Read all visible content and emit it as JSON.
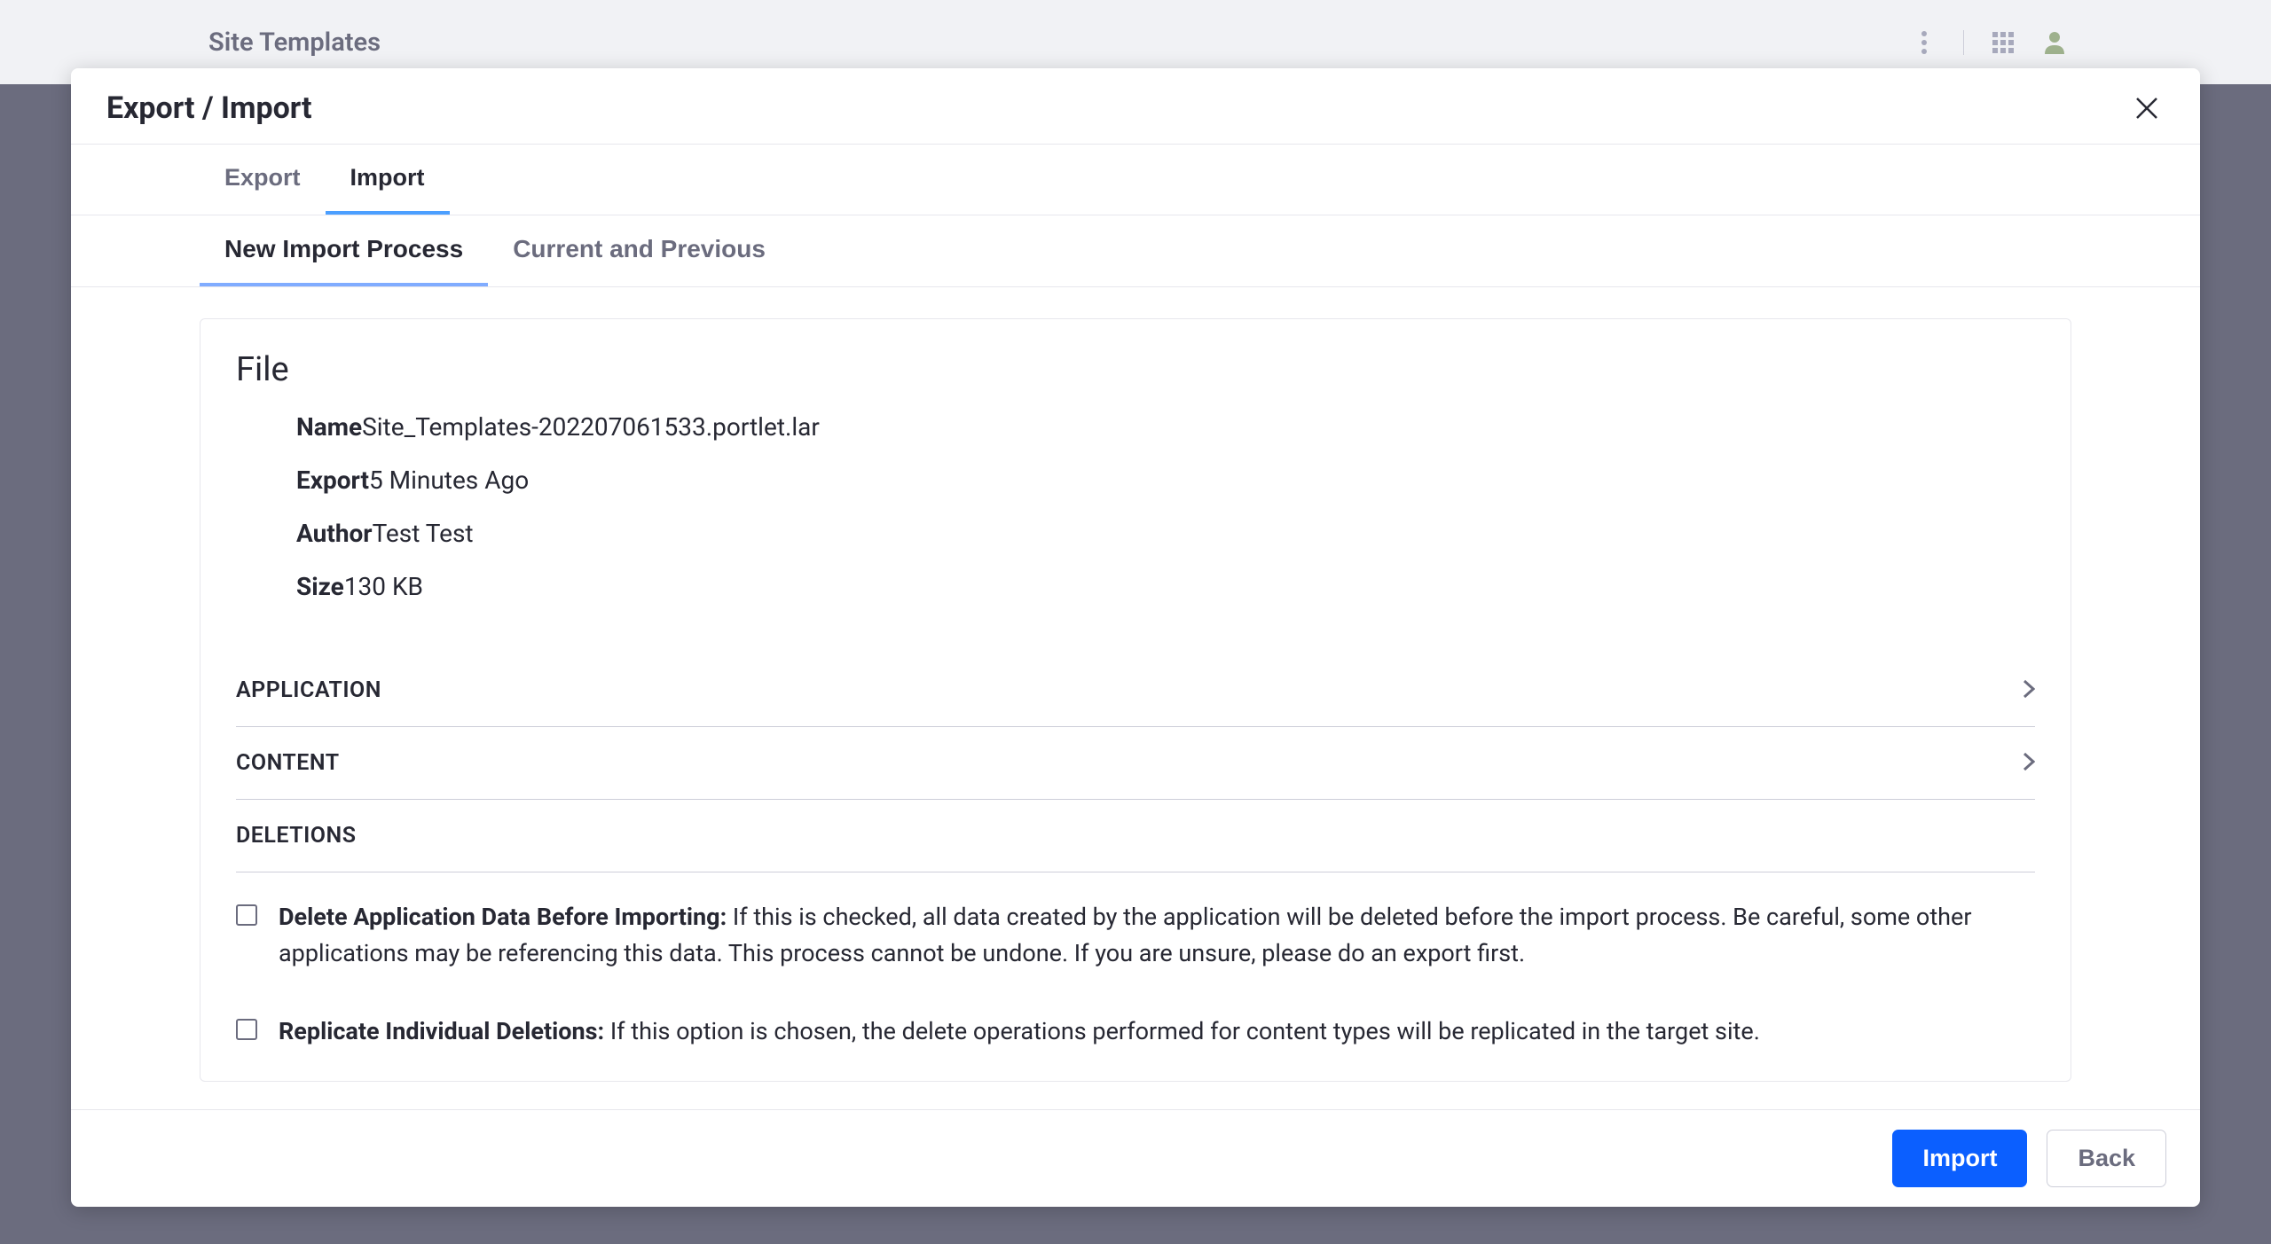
{
  "background": {
    "title": "Site Templates"
  },
  "modal": {
    "title": "Export / Import"
  },
  "tabs_primary": {
    "export": "Export",
    "import": "Import"
  },
  "tabs_secondary": {
    "new_import": "New Import Process",
    "current_previous": "Current and Previous"
  },
  "file": {
    "section_title": "File",
    "name_label": "Name",
    "name_value": "Site_Templates-202207061533.portlet.lar",
    "export_label": "Export",
    "export_value": "5 Minutes Ago",
    "author_label": "Author",
    "author_value": "Test Test",
    "size_label": "Size",
    "size_value": "130 KB"
  },
  "sections": {
    "application": "APPLICATION",
    "content": "CONTENT",
    "deletions": "DELETIONS"
  },
  "deletions": {
    "delete_data_label": "Delete Application Data Before Importing: ",
    "delete_data_text": "If this is checked, all data created by the application will be deleted before the import process. Be careful, some other applications may be referencing this data. This process cannot be undone. If you are unsure, please do an export first.",
    "replicate_label": "Replicate Individual Deletions: ",
    "replicate_text": "If this option is chosen, the delete operations performed for content types will be replicated in the target site."
  },
  "footer": {
    "import": "Import",
    "back": "Back"
  }
}
